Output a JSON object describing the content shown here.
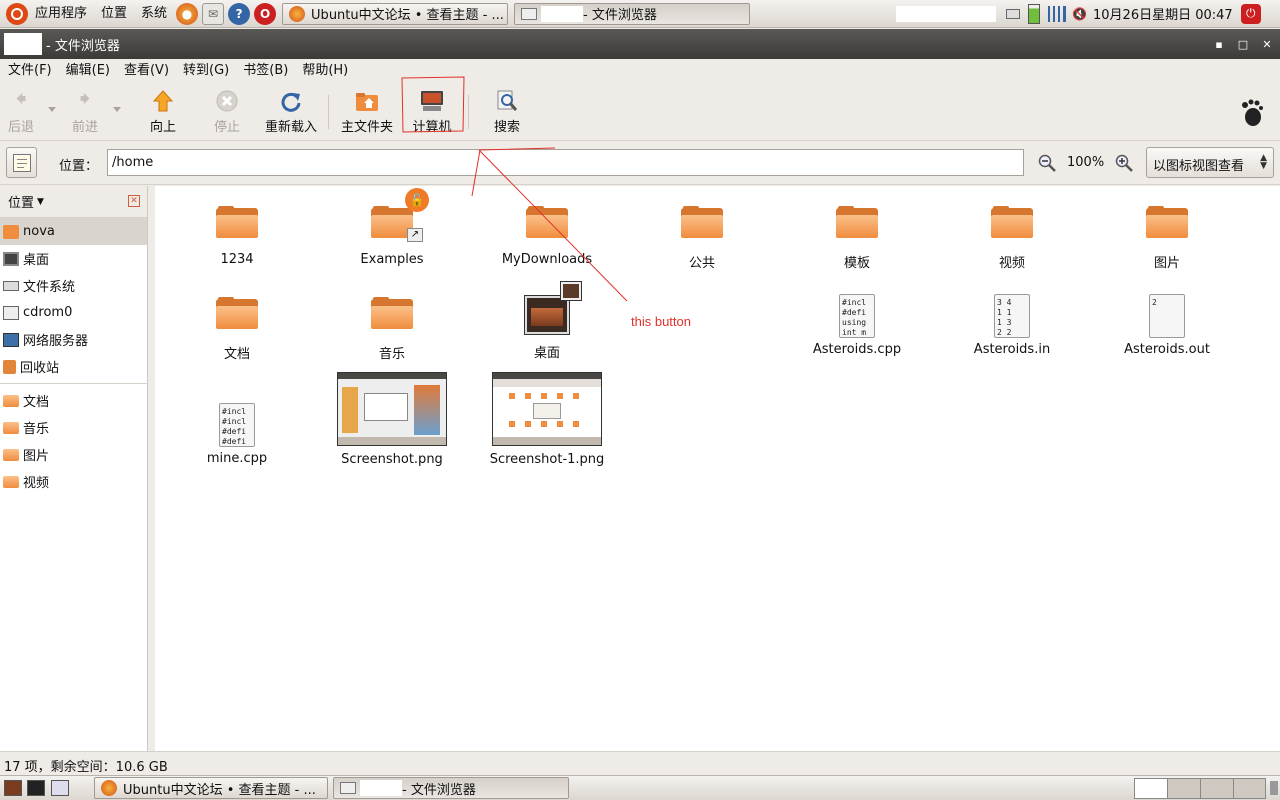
{
  "top_panel": {
    "menus": [
      "应用程序",
      "位置",
      "系统"
    ],
    "tasks": [
      {
        "title": "Ubuntu中文论坛 • 查看主题 - ...",
        "icon": "firefox-icon"
      },
      {
        "title": "- 文件浏览器",
        "icon": "file-browser-icon"
      }
    ],
    "clock": "10月26日星期日 00:47"
  },
  "window": {
    "title": "- 文件浏览器"
  },
  "menubar": [
    "文件(F)",
    "编辑(E)",
    "查看(V)",
    "转到(G)",
    "书签(B)",
    "帮助(H)"
  ],
  "toolbar": {
    "back": "后退",
    "forward": "前进",
    "up": "向上",
    "stop": "停止",
    "reload": "重新载入",
    "home": "主文件夹",
    "computer": "计算机",
    "search": "搜索"
  },
  "location": {
    "label": "位置：",
    "path": "/home",
    "zoom": "100%",
    "view_mode": "以图标视图查看"
  },
  "sidebar": {
    "header": "位置",
    "items": [
      {
        "label": "nova",
        "icon": "home-folder-icon",
        "selected": true
      },
      {
        "label": "桌面",
        "icon": "desktop-icon"
      },
      {
        "label": "文件系统",
        "icon": "drive-icon"
      },
      {
        "label": "cdrom0",
        "icon": "cdrom-icon"
      },
      {
        "label": "网络服务器",
        "icon": "network-icon"
      },
      {
        "label": "回收站",
        "icon": "trash-icon"
      }
    ],
    "bookmarks": [
      {
        "label": "文档",
        "icon": "folder-icon"
      },
      {
        "label": "音乐",
        "icon": "folder-icon"
      },
      {
        "label": "图片",
        "icon": "folder-icon"
      },
      {
        "label": "视频",
        "icon": "folder-icon"
      }
    ]
  },
  "files": [
    {
      "name": "1234",
      "type": "folder"
    },
    {
      "name": "Examples",
      "type": "folder-link"
    },
    {
      "name": "MyDownloads",
      "type": "folder"
    },
    {
      "name": "公共",
      "type": "folder"
    },
    {
      "name": "模板",
      "type": "folder"
    },
    {
      "name": "视频",
      "type": "folder"
    },
    {
      "name": "图片",
      "type": "folder"
    },
    {
      "name": "文档",
      "type": "folder"
    },
    {
      "name": "音乐",
      "type": "folder"
    },
    {
      "name": "桌面",
      "type": "desktop-folder"
    },
    {
      "name": "Asteroids.cpp",
      "type": "text",
      "preview": "#incl\n#defi\nusing\nint m"
    },
    {
      "name": "Asteroids.in",
      "type": "text",
      "preview": "3 4\n1 1\n1 3\n2 2"
    },
    {
      "name": "Asteroids.out",
      "type": "text",
      "preview": "2"
    },
    {
      "name": "mine.cpp",
      "type": "text",
      "preview": "#incl\n#incl\n#defi\n#defi"
    },
    {
      "name": "Screenshot.png",
      "type": "image"
    },
    {
      "name": "Screenshot-1.png",
      "type": "image"
    }
  ],
  "status": "17 项，剩余空间：10.6 GB",
  "annotation": "this button",
  "colors": {
    "folder": "#f08c3d",
    "annotation": "#e0312a",
    "titlebar": "#3c3b38"
  }
}
